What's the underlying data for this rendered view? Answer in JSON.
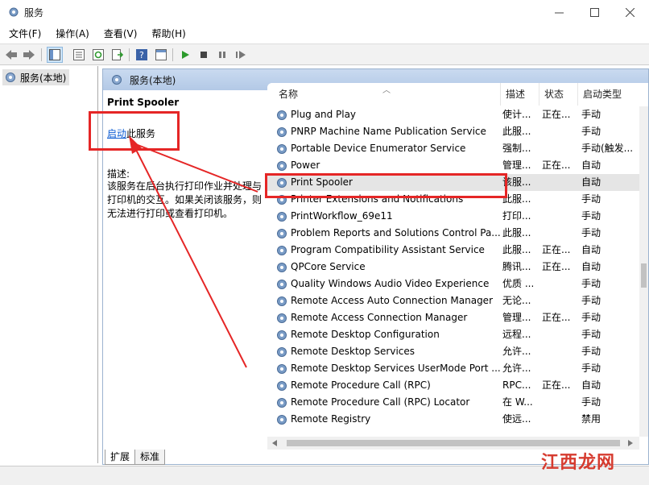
{
  "window": {
    "title": "服务",
    "icon": "gear-icon",
    "buttons": [
      "minimize",
      "maximize",
      "close"
    ]
  },
  "menu": [
    "文件(F)",
    "操作(A)",
    "查看(V)",
    "帮助(H)"
  ],
  "tree": {
    "selected": "服务(本地)"
  },
  "panel": {
    "header": "服务(本地)"
  },
  "details": {
    "title": "Print Spooler",
    "start_link": "启动",
    "start_suffix": "此服务",
    "desc_label": "描述:",
    "desc_text": "该服务在后台执行打印作业并处理与打印机的交互。如果关闭该服务，则无法进行打印或查看打印机。"
  },
  "columns": {
    "name": "名称",
    "desc": "描述",
    "status": "状态",
    "startup": "启动类型"
  },
  "rows": [
    {
      "name": "Plug and Play",
      "desc": "使计...",
      "status": "正在...",
      "startup": "手动"
    },
    {
      "name": "PNRP Machine Name Publication Service",
      "desc": "此服...",
      "status": "",
      "startup": "手动"
    },
    {
      "name": "Portable Device Enumerator Service",
      "desc": "强制...",
      "status": "",
      "startup": "手动(触发..."
    },
    {
      "name": "Power",
      "desc": "管理...",
      "status": "正在...",
      "startup": "自动"
    },
    {
      "name": "Print Spooler",
      "desc": "该服...",
      "status": "",
      "startup": "自动"
    },
    {
      "name": "Printer Extensions and Notifications",
      "desc": "此服...",
      "status": "",
      "startup": "手动"
    },
    {
      "name": "PrintWorkflow_69e11",
      "desc": "打印...",
      "status": "",
      "startup": "手动"
    },
    {
      "name": "Problem Reports and Solutions Control Pa...",
      "desc": "此服...",
      "status": "",
      "startup": "手动"
    },
    {
      "name": "Program Compatibility Assistant Service",
      "desc": "此服...",
      "status": "正在...",
      "startup": "自动"
    },
    {
      "name": "QPCore Service",
      "desc": "腾讯...",
      "status": "正在...",
      "startup": "自动"
    },
    {
      "name": "Quality Windows Audio Video Experience",
      "desc": "优质 ...",
      "status": "",
      "startup": "手动"
    },
    {
      "name": "Remote Access Auto Connection Manager",
      "desc": "无论...",
      "status": "",
      "startup": "手动"
    },
    {
      "name": "Remote Access Connection Manager",
      "desc": "管理...",
      "status": "正在...",
      "startup": "手动"
    },
    {
      "name": "Remote Desktop Configuration",
      "desc": "远程...",
      "status": "",
      "startup": "手动"
    },
    {
      "name": "Remote Desktop Services",
      "desc": "允许...",
      "status": "",
      "startup": "手动"
    },
    {
      "name": "Remote Desktop Services UserMode Port ...",
      "desc": "允许...",
      "status": "",
      "startup": "手动"
    },
    {
      "name": "Remote Procedure Call (RPC)",
      "desc": "RPC...",
      "status": "正在...",
      "startup": "自动"
    },
    {
      "name": "Remote Procedure Call (RPC) Locator",
      "desc": "在 W...",
      "status": "",
      "startup": "手动"
    },
    {
      "name": "Remote Registry",
      "desc": "使远...",
      "status": "",
      "startup": "禁用"
    }
  ],
  "selected_row": "Print Spooler",
  "tabs": [
    "扩展",
    "标准"
  ],
  "watermark": "江西龙网",
  "colors": {
    "highlight": "#e52626",
    "link": "#0b5bd3",
    "header": "#c9daf0"
  }
}
